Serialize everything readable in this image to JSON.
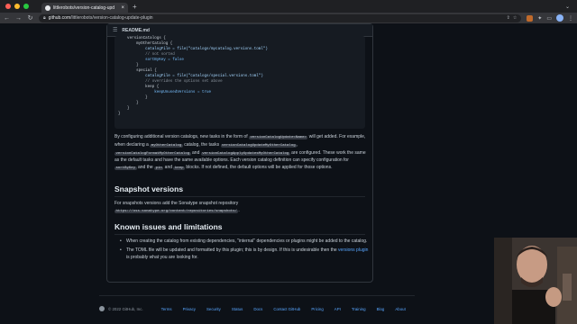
{
  "browser": {
    "tab_title": "littlerobots/version-catalog-upd",
    "url_host": "github.com",
    "url_path": "/littlerobots/version-catalog-update-plugin"
  },
  "readme": {
    "header_label": "README.md",
    "code_lines": [
      "    versionCatalogs {",
      "        myOtherCatalog {",
      "            catalogFile = file(\"catalogs/mycatalog.versions.toml\")",
      "            // not sorted",
      "            sortByKey = false",
      "        }",
      "        special {",
      "            catalogFile = file(\"catalogs/special.versions.toml\")",
      "            // overrides the options set above",
      "            keep {",
      "                keepUnusedVersions = true",
      "            }",
      "        }",
      "    }",
      "}"
    ],
    "para1": {
      "t1": "By configuring additional version catalogs, new tasks in the form of ",
      "c1": "versionCatalogUpdate<Name>",
      "t2": " will get added. For example, when declaring a ",
      "c2": "myOtherCatalog",
      "t3": " catalog, the tasks ",
      "c3": "versionCatalogUpdateMyOtherCatalog",
      "t4": ", ",
      "c4": "versionCatalogFormatMyOtherCatalog",
      "t5": " and ",
      "c5": "versionCatalogApplyUpdatesMyOtherCatalog",
      "t6": " are configured. These work the same as the default tasks and have the same available options. Each version catalog definition can specify configuration for ",
      "c6": "sortByKey",
      "t7": " and the ",
      "c7": "pin",
      "t8": " and ",
      "c8": "keep",
      "t9": " blocks. If not defined, the default options will be applied for those options."
    },
    "snapshot_heading": "Snapshot versions",
    "snapshot_text": "For snapshots versions add the Sonatype snapshot repository",
    "snapshot_url": "https://oss.sonatype.org/content/repositories/snapshots/",
    "snapshot_dot": ".",
    "known_heading": "Known issues and limitations",
    "bullet1": "When creating the catalog from existing dependencies, \"internal\" dependencies or plugins might be added to the catalog.",
    "bullet2_pre": "The TOML file will be updated and formatted by this plugin; this is by design. If this is undesirable then the ",
    "bullet2_link": "versions plugin",
    "bullet2_post": " is probably what you are looking for."
  },
  "footer": {
    "copyright": "© 2022 GitHub, Inc.",
    "links": [
      "Terms",
      "Privacy",
      "Security",
      "Status",
      "Docs",
      "Contact GitHub",
      "Pricing",
      "API",
      "Training",
      "Blog",
      "About"
    ]
  },
  "colors": {
    "link": "#58a6ff",
    "background": "#0d1117"
  }
}
